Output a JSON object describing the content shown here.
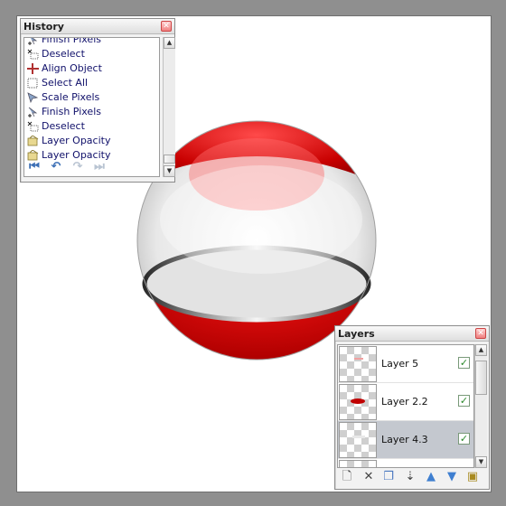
{
  "history_panel": {
    "title": "History",
    "close_icon": "close-icon",
    "items": [
      {
        "label": "Finish Pixels",
        "icon": "finish-pixels-icon"
      },
      {
        "label": "Deselect",
        "icon": "deselect-icon"
      },
      {
        "label": "Align Object",
        "icon": "align-object-icon"
      },
      {
        "label": "Select All",
        "icon": "select-all-icon"
      },
      {
        "label": "Scale Pixels",
        "icon": "scale-pixels-icon"
      },
      {
        "label": "Finish Pixels",
        "icon": "finish-pixels-icon"
      },
      {
        "label": "Deselect",
        "icon": "deselect-icon"
      },
      {
        "label": "Layer Opacity",
        "icon": "layer-properties-icon"
      },
      {
        "label": "Layer Opacity",
        "icon": "layer-properties-icon"
      }
    ],
    "toolbar": [
      "first-step-icon",
      "undo-icon",
      "redo-icon",
      "last-step-icon"
    ]
  },
  "layers_panel": {
    "title": "Layers",
    "close_icon": "close-icon",
    "layers": [
      {
        "name": "Layer 5",
        "visible": true,
        "selected": false
      },
      {
        "name": "Layer 2.2",
        "visible": true,
        "selected": false
      },
      {
        "name": "Layer 4.3",
        "visible": true,
        "selected": true
      }
    ],
    "toolbar": [
      "add-layer-icon",
      "delete-layer-icon",
      "duplicate-layer-icon",
      "merge-layer-down-icon",
      "move-layer-up-icon",
      "move-layer-down-icon",
      "layer-properties-icon"
    ]
  },
  "colors": {
    "ball_red": "#c40000",
    "ball_glass": "#e8e8e8",
    "ring": "#555555"
  }
}
